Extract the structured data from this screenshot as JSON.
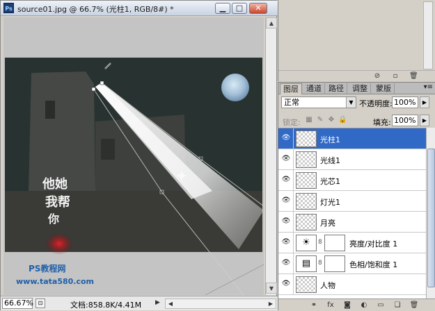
{
  "window": {
    "title": "source01.jpg @ 66.7% (光柱1, RGB/8#) *",
    "app_icon": "Ps",
    "buttons": {
      "minimize": "▁",
      "maximize": "□",
      "close": "✕"
    }
  },
  "canvas": {
    "watermark": {
      "site_name": "PS教程网",
      "site_url": "www.tata580.com"
    }
  },
  "status": {
    "zoom": "66.67%",
    "doc_info": "文档:858.8K/4.41M"
  },
  "layers_panel": {
    "tabs": [
      "图层",
      "通道",
      "路径",
      "调整",
      "蒙版"
    ],
    "active_tab": 0,
    "menu_icon": "▾≡",
    "blend_mode": "正常",
    "opacity_label": "不透明度:",
    "opacity_value": "100%",
    "lock_label": "锁定:",
    "fill_label": "填充:",
    "fill_value": "100%",
    "layers": [
      {
        "name": "光柱1",
        "selected": true,
        "thumb": "transparent"
      },
      {
        "name": "光线1",
        "selected": false,
        "thumb": "transparent"
      },
      {
        "name": "光芯1",
        "selected": false,
        "thumb": "transparent"
      },
      {
        "name": "灯光1",
        "selected": false,
        "thumb": "transparent"
      },
      {
        "name": "月亮",
        "selected": false,
        "thumb": "transparent"
      },
      {
        "name": "亮度/对比度 1",
        "selected": false,
        "thumb": "adjustment-brightness"
      },
      {
        "name": "色相/饱和度 1",
        "selected": false,
        "thumb": "adjustment-hue"
      },
      {
        "name": "人物",
        "selected": false,
        "thumb": "transparent"
      }
    ],
    "footer_icons": [
      "link-icon",
      "fx-icon",
      "mask-icon",
      "adjustment-icon",
      "folder-icon",
      "new-layer-icon",
      "trash-icon"
    ]
  },
  "colors": {
    "selection": "#3169c6",
    "panel_bg": "#d4d0c8",
    "canvas_dark": "#2a302e"
  }
}
